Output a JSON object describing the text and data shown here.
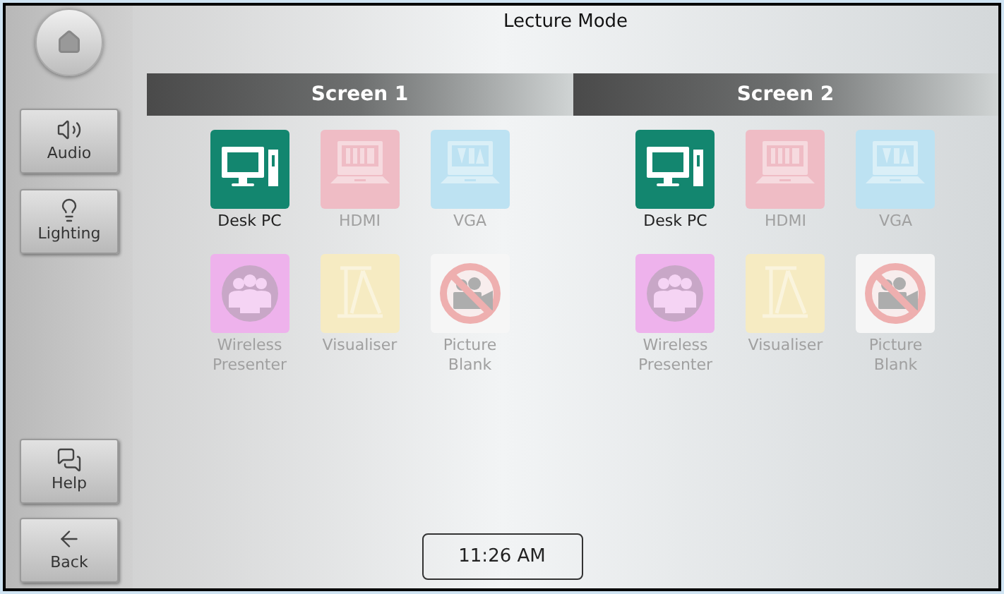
{
  "title": "Lecture Mode",
  "sidebar": {
    "home": {
      "kind": "home"
    },
    "top_buttons": [
      {
        "label": "Audio",
        "kind": "audio"
      },
      {
        "label": "Lighting",
        "kind": "lighting"
      }
    ],
    "bottom_buttons": [
      {
        "label": "Help",
        "kind": "help"
      },
      {
        "label": "Back",
        "kind": "back"
      }
    ]
  },
  "screens": [
    {
      "title": "Screen 1",
      "sources": [
        {
          "label": "Desk PC",
          "kind": "desktop",
          "color": "#13866f",
          "selected": true
        },
        {
          "label": "HDMI",
          "kind": "hdmi",
          "color": "#efbcc5",
          "selected": false
        },
        {
          "label": "VGA",
          "kind": "vga",
          "color": "#bde2f2",
          "selected": false
        },
        {
          "label": "Wireless Presenter",
          "kind": "wireless",
          "color": "#eeb2ec",
          "selected": false
        },
        {
          "label": "Visualiser",
          "kind": "visualiser",
          "color": "#f6ebc2",
          "selected": false
        },
        {
          "label": "Picture Blank",
          "kind": "blank",
          "color": "#f6f6f6",
          "selected": false
        }
      ]
    },
    {
      "title": "Screen 2",
      "sources": [
        {
          "label": "Desk PC",
          "kind": "desktop",
          "color": "#13866f",
          "selected": true
        },
        {
          "label": "HDMI",
          "kind": "hdmi",
          "color": "#efbcc5",
          "selected": false
        },
        {
          "label": "VGA",
          "kind": "vga",
          "color": "#bde2f2",
          "selected": false
        },
        {
          "label": "Wireless Presenter",
          "kind": "wireless",
          "color": "#eeb2ec",
          "selected": false
        },
        {
          "label": "Visualiser",
          "kind": "visualiser",
          "color": "#f6ebc2",
          "selected": false
        },
        {
          "label": "Picture Blank",
          "kind": "blank",
          "color": "#f6f6f6",
          "selected": false
        }
      ]
    }
  ],
  "clock": "11:26 AM"
}
